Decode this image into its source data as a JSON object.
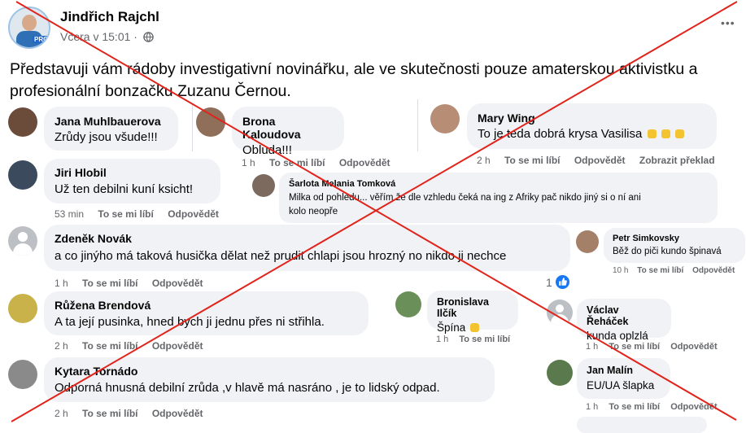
{
  "post": {
    "author": "Jindřich Rajchl",
    "time": "Včera v 15:01 ·",
    "text_line1": "Představuji vám rádoby investigativní novinářku, ale ve skutečnosti pouze amaterskou aktivistku a",
    "text_line2": "profesionální bonzačku Zuzanu Černou.",
    "avatar_badge": "PRO",
    "more_label": "•••"
  },
  "actions": {
    "like": "To se mi líbí",
    "reply": "Odpovědět",
    "translate": "Zobrazit překlad"
  },
  "comments": {
    "c1": {
      "name": "Jana Muhlbauerova",
      "text": "Zrůdy jsou všude!!!"
    },
    "c2": {
      "name": "Brona Kaloudova",
      "text": "Obluda!!!",
      "time": "1 h"
    },
    "c3": {
      "name": "Mary Wing",
      "text": "To je teda dobrá krysa Vasilisa",
      "time": "2 h"
    },
    "c4": {
      "name": "Jiri Hlobil",
      "text": "Už ten debilni kuní ksicht!",
      "time": "53 min"
    },
    "c5": {
      "name": "Šarlota Melania Tomková",
      "text1": "Milka od pohledu... věřím že dle vzhledu čeká na ing z Afriky pač nikdo jiný si o ní ani",
      "text2": "kolo neopře"
    },
    "c6": {
      "name": "Zdeněk Novák",
      "text": "a co jinýho má taková husička dělat než prudit chlapi jsou hrozný no nikdo ji nechce",
      "time": "1 h",
      "reactions": "1"
    },
    "c7": {
      "name": "Petr Simkovsky",
      "text": "Běž do piči kundo špinavá",
      "time": "10 h"
    },
    "c8": {
      "name": "Růžena Brendová",
      "text": "A ta její pusinka, hned bych ji jednu přes ni střihla.",
      "time": "2 h"
    },
    "c9": {
      "name": "Bronislava Ilčík",
      "text": "Špína",
      "time": "1 h"
    },
    "c10": {
      "name": "Václav Řeháček",
      "text": "kunda oplzlá",
      "time": "1 h"
    },
    "c11": {
      "name": "Kytara Tornádo",
      "text": "Odporná hnusná debilní zrůda ,v hlavě má nasráno , je to lidský odpad.",
      "time": "2 h"
    },
    "c12": {
      "name": "Jan Malín",
      "text": "EU/UA šlapka",
      "time": "1 h"
    }
  },
  "colors": {
    "cross": "#e0241b",
    "link": "#1877f2",
    "bubble": "#f0f2f5",
    "meta": "#65676b"
  }
}
